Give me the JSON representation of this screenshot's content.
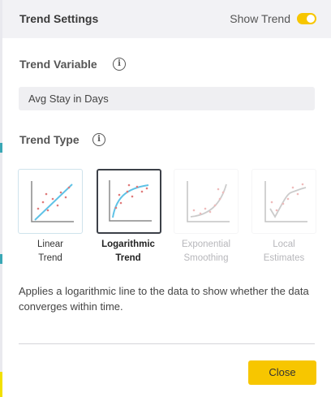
{
  "header": {
    "title": "Trend Settings",
    "show_trend_label": "Show Trend",
    "show_trend_enabled": true
  },
  "trend_variable": {
    "label": "Trend Variable",
    "selected_value": "Avg Stay in Days",
    "info_icon": "info-icon"
  },
  "trend_type": {
    "label": "Trend Type",
    "info_icon": "info-icon",
    "options": [
      {
        "line1": "Linear",
        "line2": "Trend",
        "state": "enabled",
        "icon": "linear-trend-icon"
      },
      {
        "line1": "Logarithmic",
        "line2": "Trend",
        "state": "selected",
        "icon": "logarithmic-trend-icon"
      },
      {
        "line1": "Exponential",
        "line2": "Smoothing",
        "state": "disabled",
        "icon": "exponential-smoothing-icon"
      },
      {
        "line1": "Local",
        "line2": "Estimates",
        "state": "disabled",
        "icon": "local-estimates-icon"
      }
    ]
  },
  "description": "Applies a logarithmic line to the data to show whether the data converges within time.",
  "footer": {
    "close_label": "Close"
  },
  "colors": {
    "accent_yellow": "#f7c600",
    "trend_blue": "#5fc2e6",
    "dot_red": "#e07a7a",
    "selected_border": "#3c4048"
  }
}
